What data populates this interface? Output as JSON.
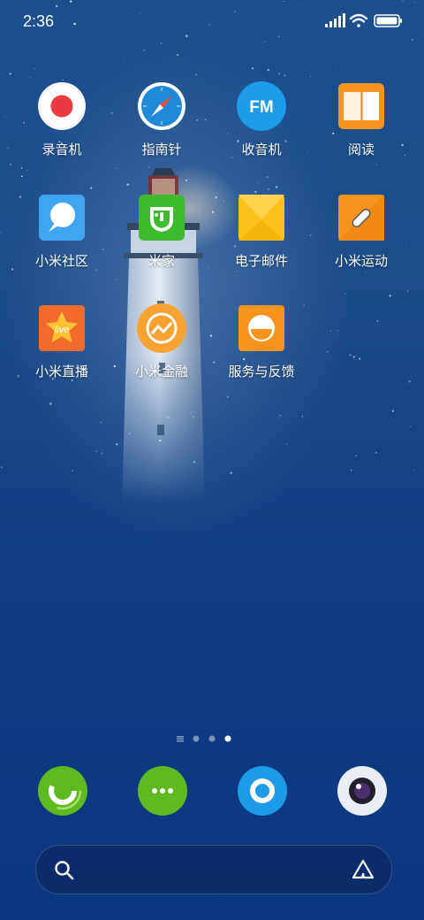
{
  "status_bar": {
    "time": "2:36",
    "icons": [
      "signal-icon",
      "wifi-icon",
      "battery-icon"
    ]
  },
  "home_apps": [
    {
      "label": "录音机",
      "icon": "record-icon"
    },
    {
      "label": "指南针",
      "icon": "compass-icon"
    },
    {
      "label": "收音机",
      "icon": "fm-radio-icon",
      "icon_text": "FM"
    },
    {
      "label": "阅读",
      "icon": "book-icon"
    },
    {
      "label": "小米社区",
      "icon": "community-icon"
    },
    {
      "label": "米家",
      "icon": "mijia-icon"
    },
    {
      "label": "电子邮件",
      "icon": "email-icon"
    },
    {
      "label": "小米运动",
      "icon": "sport-icon"
    },
    {
      "label": "小米直播",
      "icon": "live-icon",
      "icon_text": "live"
    },
    {
      "label": "小米金融",
      "icon": "finance-icon"
    },
    {
      "label": "服务与反馈",
      "icon": "feedback-icon"
    }
  ],
  "page_indicator": {
    "pages": 3,
    "current": 3
  },
  "dock": [
    {
      "icon": "phone-icon"
    },
    {
      "icon": "messages-icon"
    },
    {
      "icon": "browser-icon"
    },
    {
      "icon": "camera-icon"
    }
  ],
  "search_bar": {
    "left_icon": "search-icon",
    "right_icon": "assistant-icon"
  }
}
